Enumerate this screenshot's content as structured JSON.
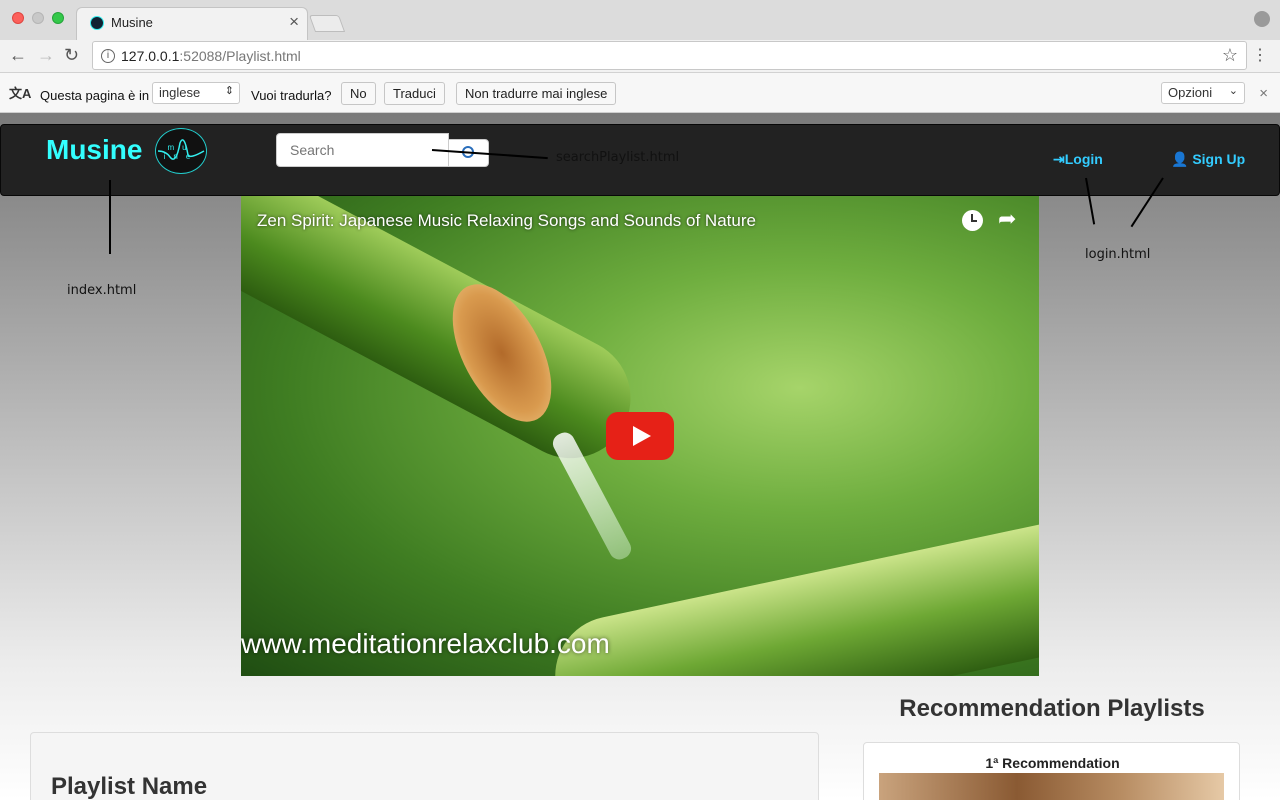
{
  "browser": {
    "tab_title": "Musine",
    "url_host": "127.0.0.1",
    "url_rest": ":52088/Playlist.html"
  },
  "translate_bar": {
    "prefix": "Questa pagina è in",
    "language": "inglese",
    "question": "Vuoi tradurla?",
    "no_label": "No",
    "translate_label": "Traduci",
    "never_label": "Non tradurre mai inglese",
    "options_label": "Opzioni"
  },
  "navbar": {
    "brand": "Musine",
    "logo_text": "mu ine",
    "search_placeholder": "Search",
    "login_label": "Login",
    "signup_label": "Sign Up"
  },
  "annotations": {
    "index": "index.html",
    "search": "searchPlaylist.html",
    "login": "login.html"
  },
  "video": {
    "title": "Zen Spirit: Japanese Music Relaxing Songs and Sounds of Nature",
    "watermark": "www.meditationrelaxclub.com"
  },
  "main": {
    "playlist_name": "Playlist Name"
  },
  "recommendations": {
    "heading": "Recommendation Playlists",
    "items": [
      {
        "title": "1ª Recommendation"
      }
    ]
  },
  "colors": {
    "brand": "#33ffff",
    "nav_link": "#33ccff",
    "navbar_bg": "#222222",
    "play_button": "#e62117"
  }
}
